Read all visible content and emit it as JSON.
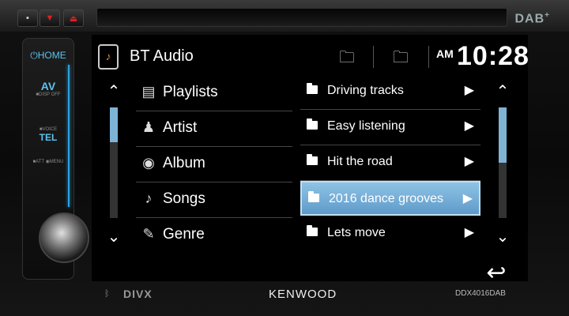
{
  "colors": {
    "accent": "#2aa3e0",
    "selection": "#7fb3d6",
    "home_text": "#5cc3f0"
  },
  "device": {
    "badge_top": "DAB",
    "badge_sup": "+",
    "bottom": {
      "bluetooth": "ᛒ",
      "divx": "DIVX",
      "brand": "KENWOOD",
      "model": "DDX4016DAB"
    }
  },
  "left_panel": {
    "home": "⏻HOME",
    "av": "AV",
    "av_sub": "■DISP OFF",
    "voice_sub": "■VOICE",
    "tel": "TEL",
    "att_sub": "■ATT ◉MENU"
  },
  "header": {
    "source_icon": "music-note-icon",
    "title": "BT Audio",
    "ampm": "AM",
    "time": "10:28"
  },
  "categories": [
    {
      "label": "Playlists",
      "icon": "playlist-icon"
    },
    {
      "label": "Artist",
      "icon": "artist-icon"
    },
    {
      "label": "Album",
      "icon": "album-icon"
    },
    {
      "label": "Songs",
      "icon": "song-icon"
    },
    {
      "label": "Genre",
      "icon": "genre-icon"
    }
  ],
  "folders": [
    {
      "label": "Driving tracks",
      "selected": false
    },
    {
      "label": "Easy listening",
      "selected": false
    },
    {
      "label": "Hit the road",
      "selected": false
    },
    {
      "label": "2016 dance grooves",
      "selected": true
    },
    {
      "label": "Lets move",
      "selected": false
    }
  ]
}
